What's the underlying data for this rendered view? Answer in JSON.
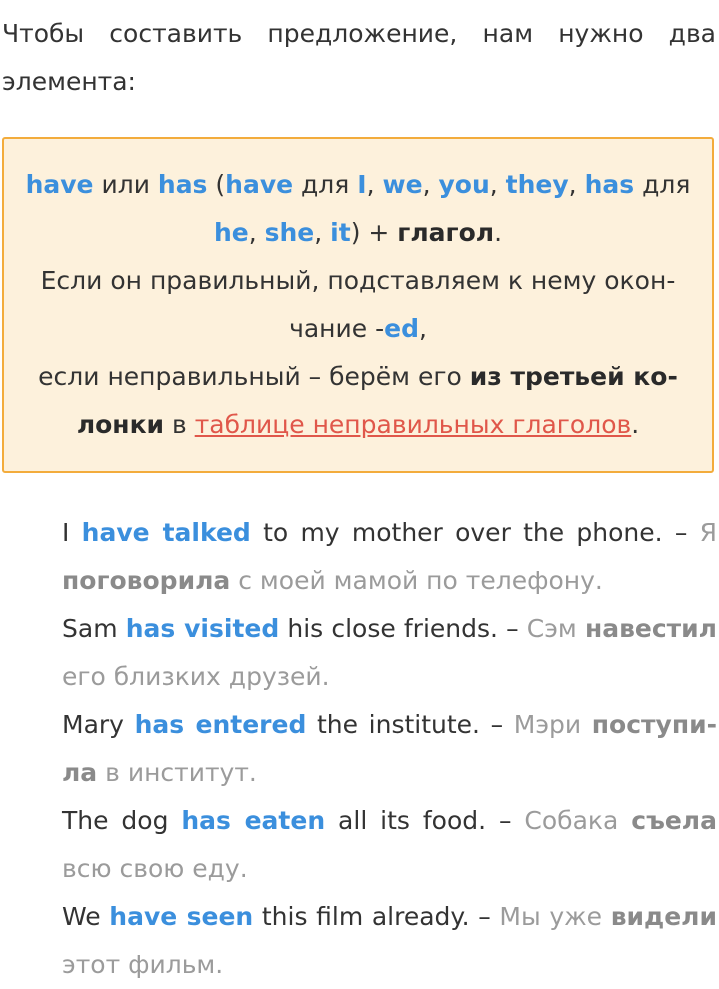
{
  "intro": {
    "text": "Чтобы составить предложение, нам нужно два элемента:"
  },
  "rule": {
    "w_have": "have",
    "w_or": " или ",
    "w_has": "has",
    "w_paren_open": " (",
    "w_have2": "have",
    "w_for": " для ",
    "w_I": "I",
    "w_comma1": ", ",
    "w_we": "we",
    "w_comma2": ", ",
    "w_you": "you",
    "w_comma3": ", ",
    "w_they": "they",
    "w_comma4": ", ",
    "w_has2": "has",
    "w_for2": " для ",
    "w_he": "he",
    "w_comma5": ", ",
    "w_she": "she",
    "w_comma6": ", ",
    "w_it": "it",
    "w_paren_close": ") + ",
    "w_verb": "глагол",
    "w_dot": ".",
    "line2_pre": "Если он правильный, подставляем к нему окон­чание -",
    "ending": "ed",
    "line2_post": ",",
    "line3_pre": "если неправильный – берём его ",
    "third_column": "из третьей ко­лонки",
    "line3_mid": " в ",
    "table_link": "таблице неправильных глаголов",
    "line3_end": "."
  },
  "examples": [
    {
      "pre": "I ",
      "verb": "have talked",
      "post": " to my mother over the phone. – ",
      "tr_pre": "Я ",
      "tr_verb": "поговорила",
      "tr_post": " с моей мамой по телефону."
    },
    {
      "pre": "Sam ",
      "verb": "has visited",
      "post": " his close friends. – ",
      "tr_pre": "Сэм ",
      "tr_verb": "наве­стил",
      "tr_post": " его близких друзей."
    },
    {
      "pre": "Mary ",
      "verb": "has entered",
      "post": " the institute. – ",
      "tr_pre": "Мэри ",
      "tr_verb": "поступи­ла",
      "tr_post": " в институт."
    },
    {
      "pre": "The dog ",
      "verb": "has eaten",
      "post": " all its food. – ",
      "tr_pre": "Собака ",
      "tr_verb": "съела",
      "tr_post": " всю свою еду."
    },
    {
      "pre": "We ",
      "verb": "have seen",
      "post": " this film already. – ",
      "tr_pre": "Мы уже ",
      "tr_verb": "виде­ли",
      "tr_post": " этот фильм."
    }
  ],
  "colors": {
    "highlight_blue": "#3b8fdd",
    "box_background": "#fdf1dc",
    "box_border": "#f3ac3c",
    "link_red": "#e0574a",
    "translation_gray": "#9b9b9b"
  }
}
